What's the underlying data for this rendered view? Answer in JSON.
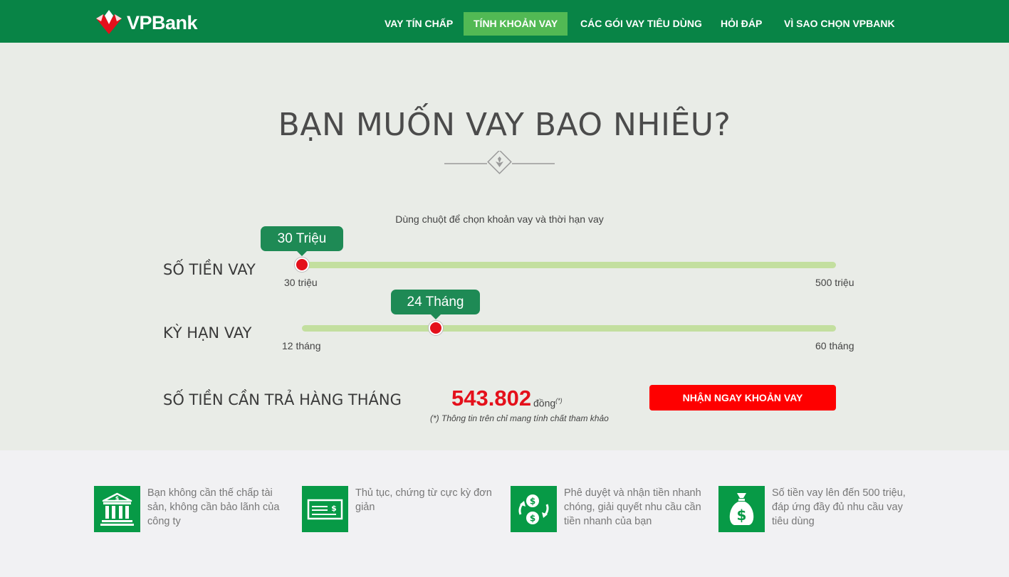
{
  "brand": {
    "name": "VPBank",
    "primary_color": "#088446",
    "accent_color": "#e4101b"
  },
  "nav": {
    "items": [
      {
        "label": "VAY TÍN CHẤP"
      },
      {
        "label": "TÍNH KHOẢN VAY",
        "active": true
      },
      {
        "label": "CÁC GÓI VAY TIÊU DÙNG"
      },
      {
        "label": "HỎI ĐÁP"
      },
      {
        "label": "VÌ SAO CHỌN VPBANK"
      }
    ]
  },
  "calculator": {
    "title": "BẠN MUỐN VAY BAO NHIÊU?",
    "hint": "Dùng chuột để chọn khoản vay và thời hạn vay",
    "amount_slider": {
      "label": "SỐ TIỀN VAY",
      "value_label": "30 Triệu",
      "value": 30,
      "min_label": "30 triệu",
      "max_label": "500 triệu",
      "min": 30,
      "max": 500
    },
    "term_slider": {
      "label": "KỲ HẠN VAY",
      "value_label": "24 Tháng",
      "value": 24,
      "min_label": "12 tháng",
      "max_label": "60 tháng",
      "min": 12,
      "max": 60
    },
    "monthly": {
      "label": "SỐ TIỀN CẦN TRẢ HÀNG THÁNG",
      "amount": "543.802",
      "unit": "đồng",
      "unit_mark": "(*)",
      "note": "(*) Thông tin trên chỉ mang tính chất tham khảo"
    },
    "cta_label": "NHẬN NGAY KHOẢN VAY"
  },
  "features": [
    {
      "icon": "bank-building-icon",
      "text": "Bạn không cần thế chấp tài sản, không cần bảo lãnh của công ty"
    },
    {
      "icon": "cheque-icon",
      "text": "Thủ tục, chứng từ cực kỳ đơn giản"
    },
    {
      "icon": "money-exchange-icon",
      "text": "Phê duyệt và nhận tiền nhanh chóng, giải quyết nhu cầu cần tiền nhanh của bạn"
    },
    {
      "icon": "money-bag-icon",
      "text": "Số tiền vay lên đến 500 triệu, đáp ứng đầy đủ nhu cầu vay tiêu dùng"
    }
  ]
}
